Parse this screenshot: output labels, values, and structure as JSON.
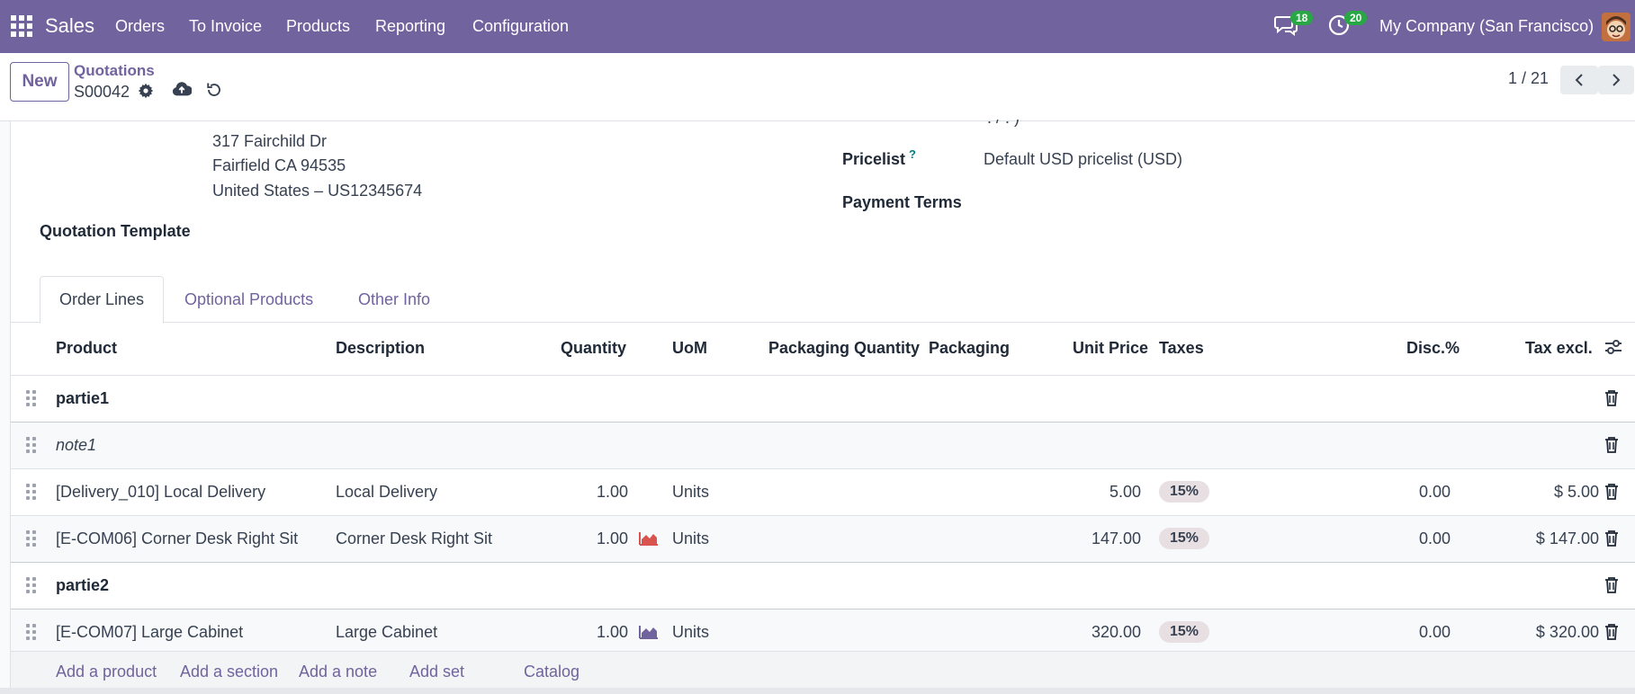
{
  "navbar": {
    "app_name": "Sales",
    "menu": [
      "Orders",
      "To Invoice",
      "Products",
      "Reporting",
      "Configuration"
    ],
    "messages_count": "18",
    "activities_count": "20",
    "company": "My Company (San Francisco)",
    "bg_color": "#71639e"
  },
  "control": {
    "new_label": "New",
    "breadcrumb_parent": "Quotations",
    "record_name": "S00042",
    "pager": "1 / 21"
  },
  "form": {
    "address_lines": [
      "317 Fairchild Dr",
      "Fairfield CA 94535",
      "United States – US12345674"
    ],
    "quotation_template_label": "Quotation Template",
    "pricelist_label": "Pricelist",
    "pricelist_help": "?",
    "pricelist_value": "Default USD pricelist (USD)",
    "payment_terms_label": "Payment Terms"
  },
  "tabs": [
    "Order Lines",
    "Optional Products",
    "Other Info"
  ],
  "table": {
    "columns": [
      "Product",
      "Description",
      "Quantity",
      "UoM",
      "Packaging Quantity",
      "Packaging",
      "Unit Price",
      "Taxes",
      "Disc.%",
      "Tax excl."
    ],
    "rows": [
      {
        "kind": "section",
        "product": "partie1"
      },
      {
        "kind": "note",
        "product": "note1"
      },
      {
        "kind": "line",
        "product": "[Delivery_010] Local Delivery",
        "description": "Local Delivery",
        "quantity": "1.00",
        "forecast": "none",
        "uom": "Units",
        "unit_price": "5.00",
        "tax": "15%",
        "discount": "0.00",
        "subtotal": "$ 5.00"
      },
      {
        "kind": "line",
        "product": "[E-COM06] Corner Desk Right Sit",
        "description": "Corner Desk Right Sit",
        "quantity": "1.00",
        "forecast": "red",
        "uom": "Units",
        "unit_price": "147.00",
        "tax": "15%",
        "discount": "0.00",
        "subtotal": "$ 147.00"
      },
      {
        "kind": "section",
        "product": "partie2"
      },
      {
        "kind": "line",
        "product": "[E-COM07] Large Cabinet",
        "description": "Large Cabinet",
        "quantity": "1.00",
        "forecast": "purple",
        "uom": "Units",
        "unit_price": "320.00",
        "tax": "15%",
        "discount": "0.00",
        "subtotal": "$ 320.00"
      }
    ],
    "footer_actions": [
      "Add a product",
      "Add a section",
      "Add a note",
      "Add set",
      "Catalog"
    ]
  },
  "colors": {
    "accent": "#71639e",
    "forecast_red": "#d9534f",
    "forecast_purple": "#71639e",
    "badge_green": "#28a745"
  }
}
